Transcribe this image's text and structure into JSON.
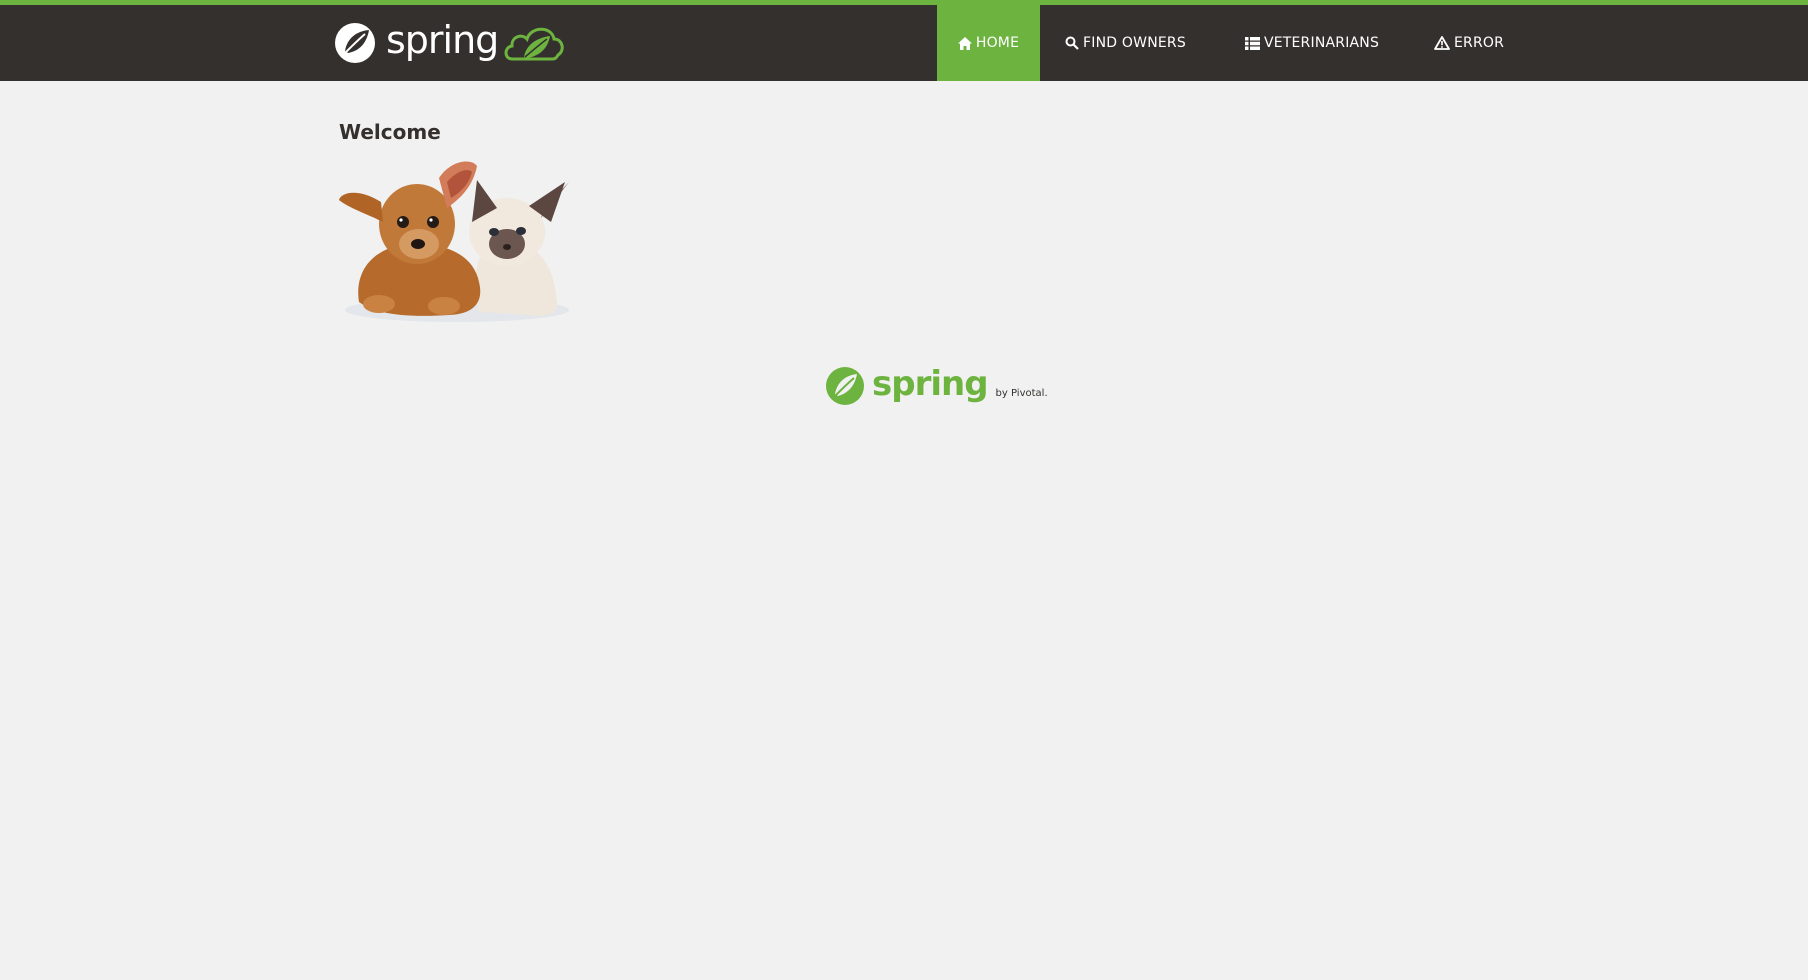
{
  "header": {
    "brand_word": "spring",
    "brand_badge_icon": "leaf-cloud-icon",
    "accent_color": "#6db33f",
    "bar_color": "#34302d"
  },
  "nav": {
    "items": [
      {
        "label": "HOME",
        "icon": "home-icon",
        "active": true
      },
      {
        "label": "FIND OWNERS",
        "icon": "search-icon",
        "active": false
      },
      {
        "label": "VETERINARIANS",
        "icon": "list-icon",
        "active": false
      },
      {
        "label": "ERROR",
        "icon": "warning-icon",
        "active": false
      }
    ]
  },
  "main": {
    "title": "Welcome",
    "image_name": "pets-image"
  },
  "footer": {
    "logo_word": "spring",
    "by_text": "by Pivotal."
  }
}
